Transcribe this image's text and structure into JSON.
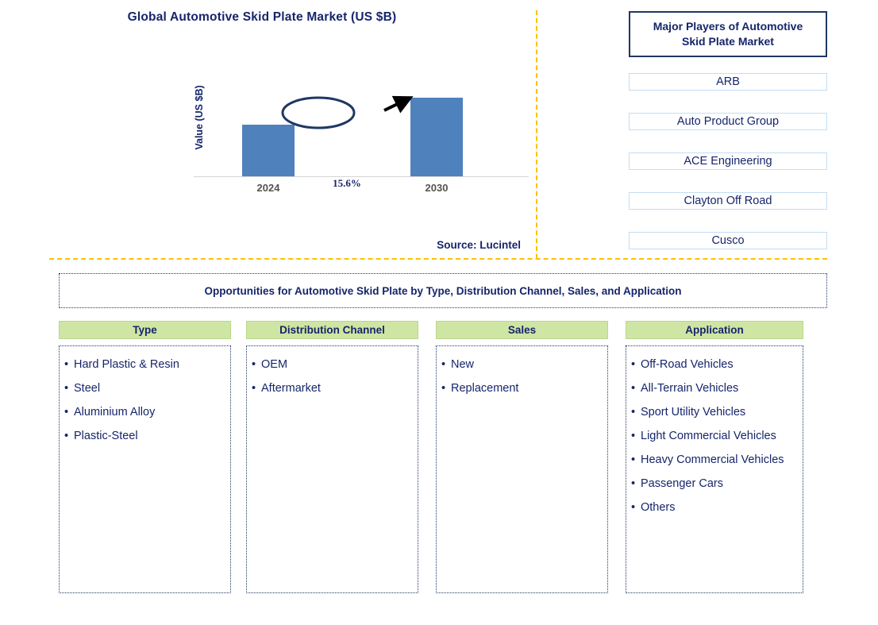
{
  "chart_title": "Global Automotive Skid Plate Market (US $B)",
  "source": "Source: Lucintel",
  "chart_data": {
    "type": "bar",
    "title": "Global Automotive Skid Plate Market (US $B)",
    "xlabel": "",
    "ylabel": "Value (US $B)",
    "categories": [
      "2024",
      "2030"
    ],
    "values": [
      65,
      99
    ],
    "annotation": "15.6%",
    "annotation_meaning": "CAGR growth arrow from 2024 bar to 2030 bar",
    "grid": false,
    "legend": false,
    "bar_color": "#4f81bd",
    "tick_labels": [
      "2024",
      "2030"
    ]
  },
  "players": {
    "header": "Major Players of Automotive Skid Plate Market",
    "header_line1": "Major Players of Automotive",
    "header_line2": "Skid Plate Market",
    "items": [
      {
        "label": "ARB"
      },
      {
        "label": "Auto Product Group"
      },
      {
        "label": "ACE Engineering"
      },
      {
        "label": "Clayton Off Road"
      },
      {
        "label": "Cusco"
      }
    ]
  },
  "opportunities": {
    "banner": "Opportunities for Automotive Skid Plate by Type, Distribution Channel, Sales, and Application",
    "columns": [
      {
        "header": "Type",
        "items": [
          "Hard Plastic & Resin",
          "Steel",
          "Aluminium Alloy",
          "Plastic-Steel"
        ]
      },
      {
        "header": "Distribution Channel",
        "items": [
          "OEM",
          "Aftermarket"
        ]
      },
      {
        "header": "Sales",
        "items": [
          "New",
          "Replacement"
        ]
      },
      {
        "header": "Application",
        "items": [
          "Off-Road Vehicles",
          "All-Terrain Vehicles",
          "Sport Utility Vehicles",
          "Light Commercial Vehicles",
          "Heavy Commercial Vehicles",
          "Passenger Cars",
          "Others"
        ]
      }
    ]
  },
  "bullet": "•",
  "colors": {
    "navy": "#16256b",
    "bar_blue": "#4f81bd",
    "header_green": "#cfe5a3",
    "divider_gold": "#ffc000"
  }
}
